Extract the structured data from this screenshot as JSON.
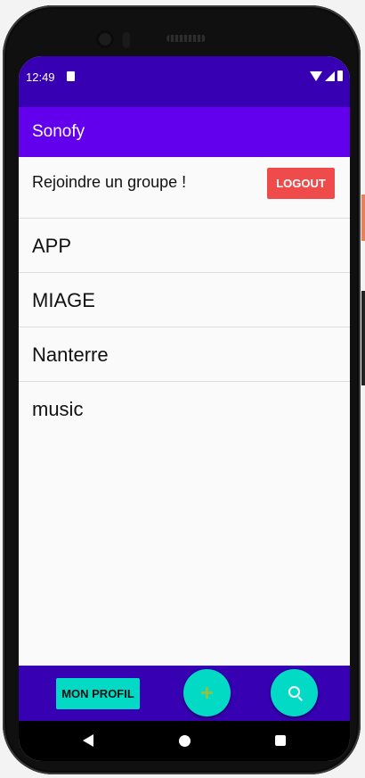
{
  "status_bar": {
    "time": "12:49"
  },
  "app_bar": {
    "title": "Sonofy"
  },
  "header": {
    "join_text": "Rejoindre un groupe !",
    "logout_label": "LOGOUT"
  },
  "groups": [
    {
      "label": "APP"
    },
    {
      "label": "MIAGE"
    },
    {
      "label": "Nanterre"
    },
    {
      "label": "music"
    }
  ],
  "bottom_bar": {
    "profile_label": "MON PROFIL",
    "add_icon": "plus-icon",
    "search_icon": "search-icon"
  },
  "colors": {
    "status_bar": "#3700b3",
    "app_bar": "#6200ee",
    "logout": "#ef4b4b",
    "accent": "#03dac5",
    "plus": "#8bc34a"
  }
}
